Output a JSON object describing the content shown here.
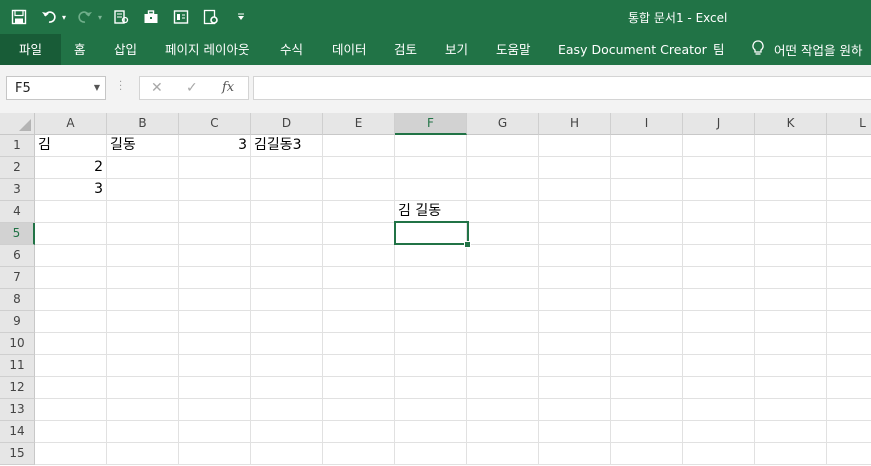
{
  "window": {
    "title": "통합 문서1  -  Excel"
  },
  "ribbon": {
    "tabs": [
      "파일",
      "홈",
      "삽입",
      "페이지 레이아웃",
      "수식",
      "데이터",
      "검토",
      "보기",
      "도움말",
      "Easy Document Creator",
      "팀"
    ],
    "tell_me": "어떤 작업을 원하"
  },
  "formula_bar": {
    "name_box": "F5",
    "fx_label": "fx",
    "content": ""
  },
  "grid": {
    "columns": [
      "A",
      "B",
      "C",
      "D",
      "E",
      "F",
      "G",
      "H",
      "I",
      "J",
      "K",
      "L"
    ],
    "rows": [
      "1",
      "2",
      "3",
      "4",
      "5",
      "6",
      "7",
      "8",
      "9",
      "10",
      "11",
      "12",
      "13",
      "14",
      "15"
    ],
    "selected_cell": "F5",
    "cells": {
      "A1": "김",
      "B1": "길동",
      "C1": "3",
      "D1": "김길동3",
      "A2": "2",
      "A3": "3",
      "F4": "김 길동"
    }
  },
  "colors": {
    "accent": "#217346",
    "tab_active": "#185c37"
  }
}
